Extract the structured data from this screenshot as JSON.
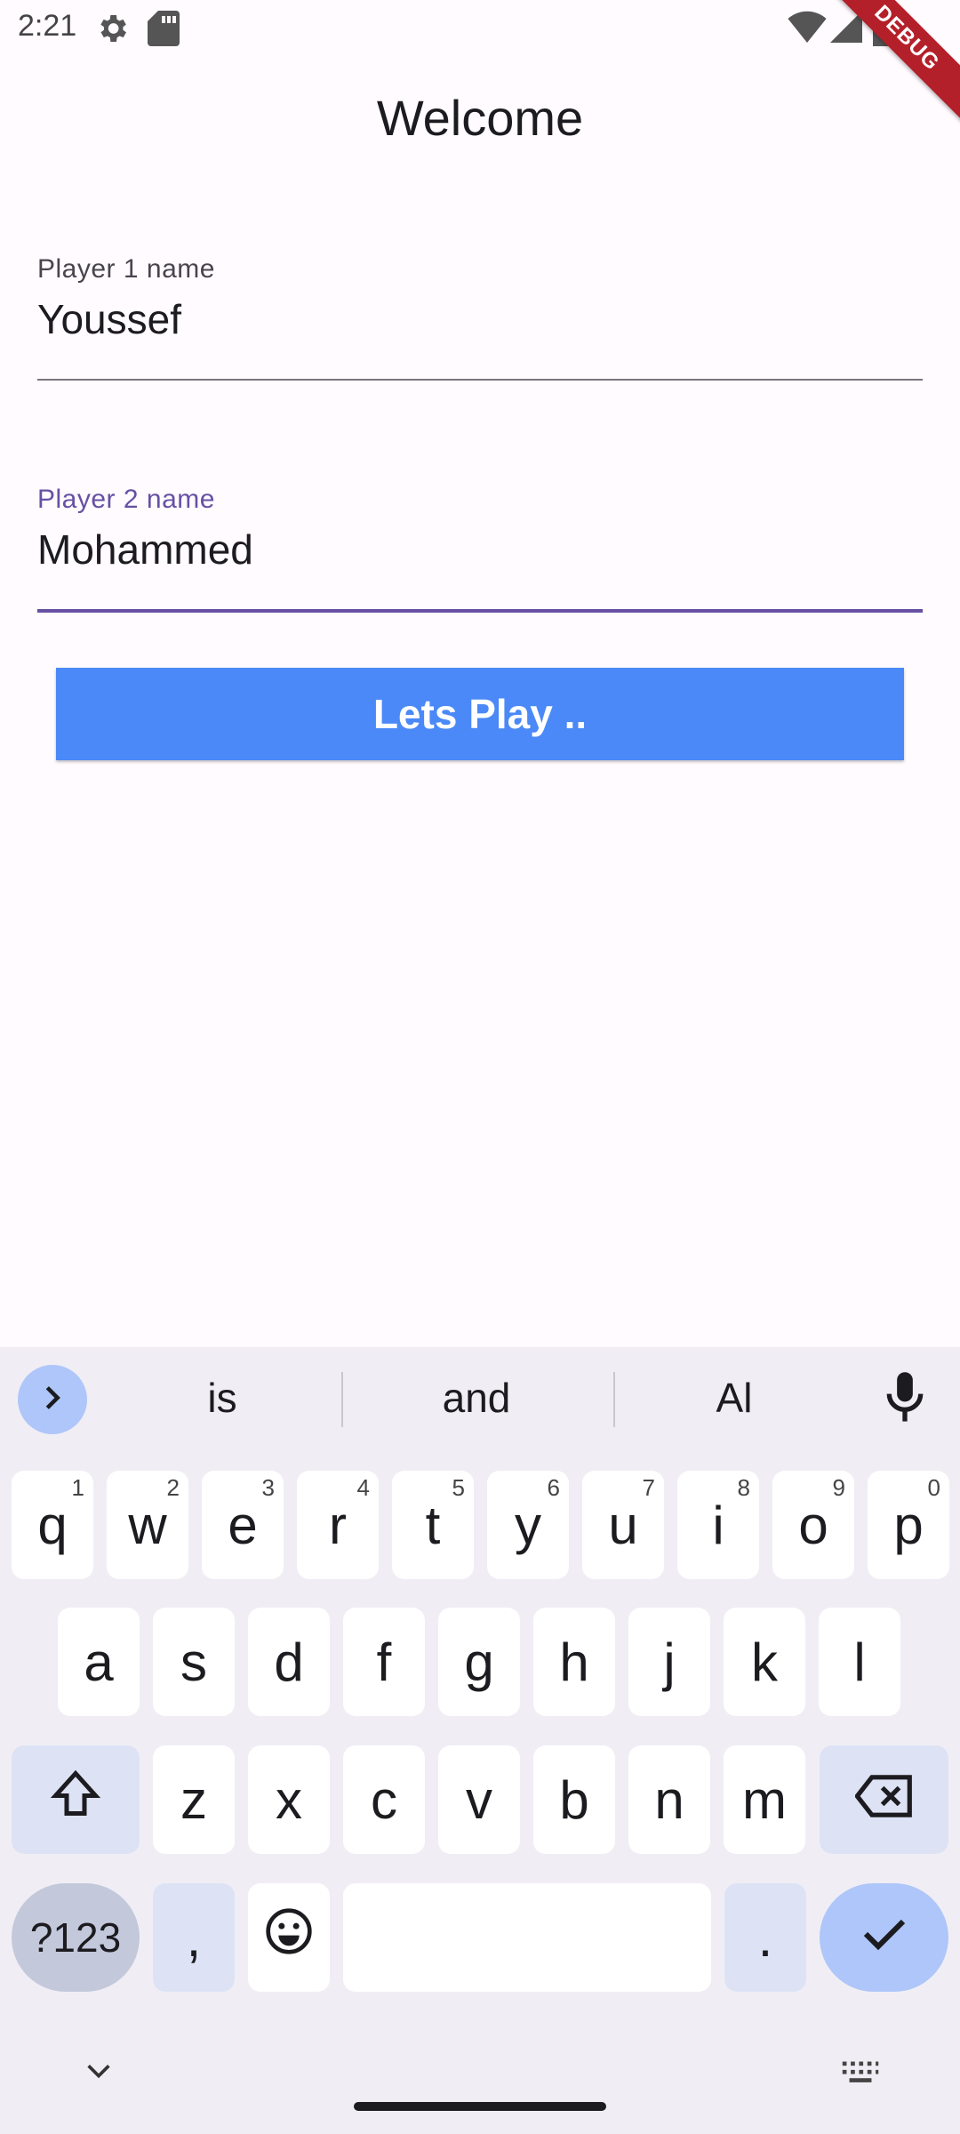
{
  "status_bar": {
    "time": "2:21",
    "debug_label": "DEBUG"
  },
  "app": {
    "title": "Welcome",
    "player1": {
      "label": "Player 1 name",
      "value": "Youssef"
    },
    "player2": {
      "label": "Player 2 name",
      "value": "Mohammed"
    },
    "play_button_label": "Lets Play .."
  },
  "keyboard": {
    "suggestions": [
      "is",
      "and",
      "Al"
    ],
    "row1": [
      {
        "k": "q",
        "h": "1"
      },
      {
        "k": "w",
        "h": "2"
      },
      {
        "k": "e",
        "h": "3"
      },
      {
        "k": "r",
        "h": "4"
      },
      {
        "k": "t",
        "h": "5"
      },
      {
        "k": "y",
        "h": "6"
      },
      {
        "k": "u",
        "h": "7"
      },
      {
        "k": "i",
        "h": "8"
      },
      {
        "k": "o",
        "h": "9"
      },
      {
        "k": "p",
        "h": "0"
      }
    ],
    "row2": [
      "a",
      "s",
      "d",
      "f",
      "g",
      "h",
      "j",
      "k",
      "l"
    ],
    "row3": [
      "z",
      "x",
      "c",
      "v",
      "b",
      "n",
      "m"
    ],
    "symbols_label": "?123",
    "comma_label": ",",
    "period_label": "."
  },
  "colors": {
    "accent": "#6750a4",
    "button": "#4a89f7",
    "debug": "#b4202a"
  }
}
